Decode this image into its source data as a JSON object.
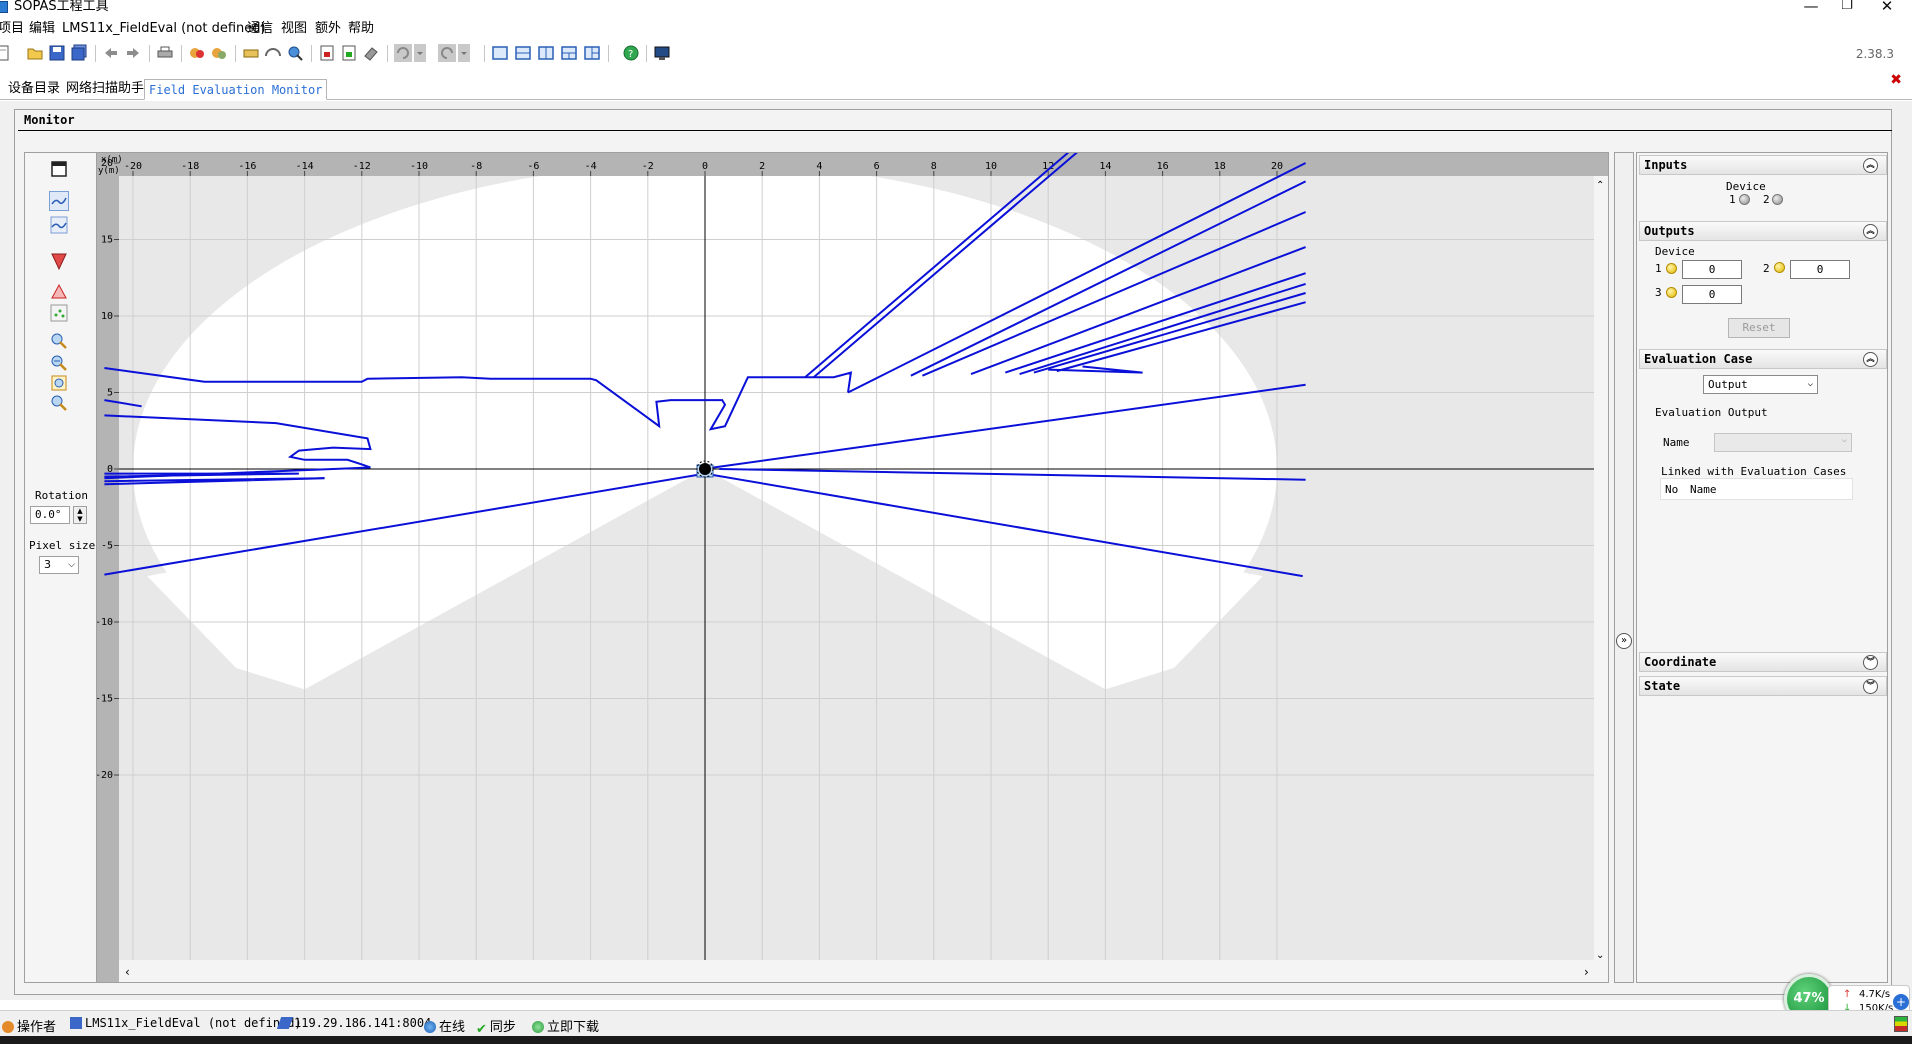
{
  "window": {
    "title": "SOPAS工程工具",
    "minimize": "—",
    "restore": "❐",
    "close": "✕"
  },
  "menu": [
    "项目",
    "编辑",
    "LMS11x_FieldEval (not defined)",
    "通信",
    "视图",
    "额外",
    "帮助"
  ],
  "toolbar": {
    "icons": [
      "new-icon",
      "open-folder-icon",
      "save-icon",
      "save-all-icon",
      "back-arrow-icon",
      "forward-arrow-icon",
      "print-icon",
      "connect-icon",
      "disconnect-icon",
      "device-icon",
      "scan-icon",
      "search-icon",
      "export-icon",
      "import-icon",
      "eraser-icon",
      "undo-icon",
      "undo-dropdown-icon",
      "redo-icon",
      "redo-dropdown-icon",
      "layout-1-icon",
      "layout-2-icon",
      "layout-3-icon",
      "layout-4-icon",
      "layout-5-icon",
      "help-icon",
      "monitor-icon"
    ],
    "version": "2.38.3"
  },
  "tabs": [
    {
      "label": "设备目录",
      "active": false
    },
    {
      "label": "网络扫描助手",
      "active": false
    },
    {
      "label": "Field Evaluation Monitor",
      "active": true
    }
  ],
  "monitor": {
    "title": "Monitor",
    "left_panel": {
      "rotation_label": "Rotation",
      "rotation_value": "0.0°",
      "pixel_size_label": "Pixel size",
      "pixel_size_value": "3",
      "icons": [
        "window-icon",
        "scan-view-icon",
        "scan-lines-icon",
        "field-icon",
        "mirror-icon",
        "points-icon",
        "zoom-in-icon",
        "zoom-out-icon",
        "zoom-fit-icon",
        "zoom-reset-icon"
      ]
    },
    "plot": {
      "x_axis_label": "x(m)",
      "y_axis_label": "y(m)",
      "x_ticks": [
        "-20",
        "-18",
        "-16",
        "-14",
        "-12",
        "-10",
        "-8",
        "-6",
        "-4",
        "-2",
        "0",
        "2",
        "4",
        "6",
        "8",
        "10",
        "12",
        "14",
        "16",
        "18",
        "20"
      ],
      "y_ticks": [
        "20",
        "15",
        "10",
        "5",
        "0",
        "-5",
        "-10",
        "-15",
        "-20"
      ],
      "colors": {
        "field": "#ffffff",
        "background": "#e8e8e8",
        "scan": "#0a10d8",
        "ruler": "#b4b4b4"
      }
    }
  },
  "right_panel": {
    "inputs": {
      "title": "Inputs",
      "device_label": "Device",
      "device_1": "1",
      "device_2": "2"
    },
    "outputs": {
      "title": "Outputs",
      "device_label": "Device",
      "items": [
        {
          "n": "1",
          "value": "0"
        },
        {
          "n": "2",
          "value": "0"
        },
        {
          "n": "3",
          "value": "0"
        }
      ],
      "reset_label": "Reset"
    },
    "evaluation_case": {
      "title": "Evaluation Case",
      "select_value": "Output",
      "group_label": "Evaluation Output",
      "name_label": "Name",
      "linked_label": "Linked with Evaluation Cases",
      "col_no": "No",
      "col_name": "Name"
    },
    "coordinate": {
      "title": "Coordinate"
    },
    "state": {
      "title": "State"
    }
  },
  "statusbar": {
    "user": "操作者",
    "device": "LMS11x_FieldEval (not defined)",
    "address": "119.29.186.141:8004",
    "online": "在线",
    "sync": "同步",
    "download": "立即下载"
  },
  "netmon": {
    "percent": "47%",
    "up": "4.7K/s",
    "down": "150K/s"
  }
}
